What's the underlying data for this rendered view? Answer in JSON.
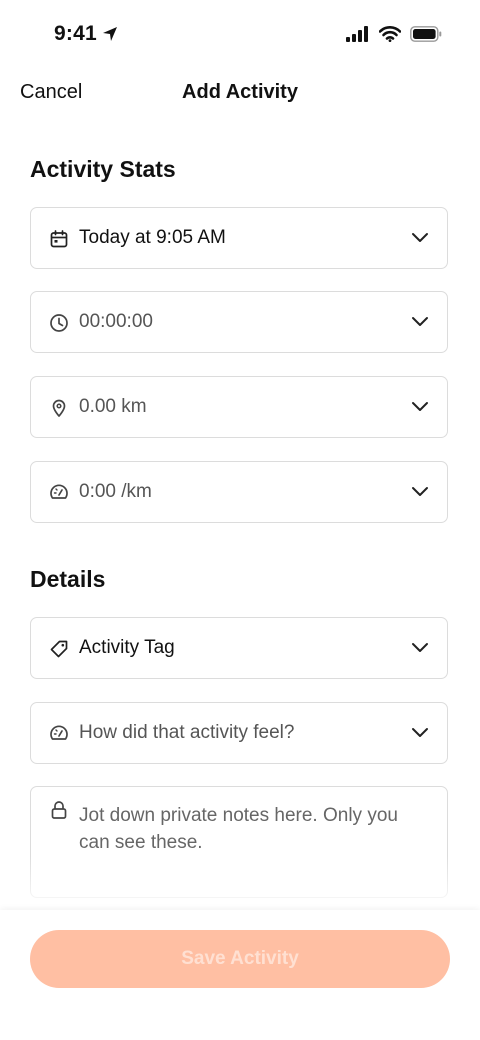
{
  "status_bar": {
    "time": "9:41"
  },
  "nav": {
    "cancel_label": "Cancel",
    "title": "Add Activity"
  },
  "activity_stats": {
    "title": "Activity Stats",
    "fields": [
      {
        "icon": "calendar-icon",
        "value": "Today at 9:05 AM"
      },
      {
        "icon": "clock-icon",
        "value": "00:00:00"
      },
      {
        "icon": "location-pin-icon",
        "value": "0.00 km"
      },
      {
        "icon": "speedometer-icon",
        "value": "0:00 /km"
      }
    ]
  },
  "details": {
    "title": "Details",
    "tag_placeholder": "Activity Tag",
    "feel_placeholder": "How did that activity feel?",
    "notes_placeholder": "Jot down private notes here. Only you can see these."
  },
  "footer": {
    "save_label": "Save Activity"
  },
  "colors": {
    "save_button_bg": "#ffbfa3",
    "save_button_text": "#ffe0d2",
    "field_border": "#dcdcdc"
  }
}
